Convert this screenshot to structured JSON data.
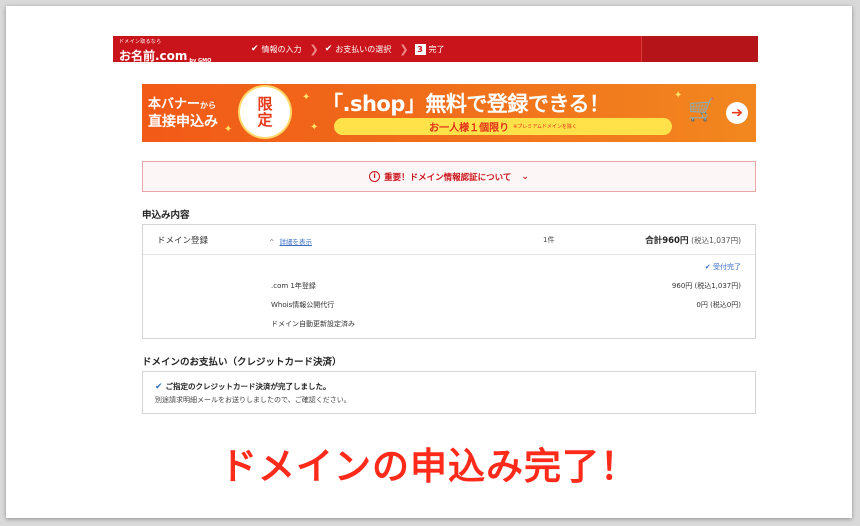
{
  "header": {
    "logo_small": "ドメイン取るなら",
    "logo_main": "お名前.com",
    "logo_gmo": "by GMO",
    "steps": [
      {
        "label": "情報の入力",
        "state": "done"
      },
      {
        "label": "お支払いの選択",
        "state": "done"
      },
      {
        "label": "完了",
        "number": "3",
        "state": "current"
      }
    ]
  },
  "banner": {
    "left_line1": "本バナー",
    "left_line1_small": "から",
    "left_line2": "直接申込み",
    "circle_text1": "限",
    "circle_text2": "定",
    "title": "「.shop」無料で登録できる！",
    "subtitle": "お一人様１個限り",
    "subtitle_note": "※プレミアムドメインを除く",
    "arrow": "➔"
  },
  "notice": {
    "icon": "i",
    "text": "重要！ドメイン情報認証について",
    "chevron": "﹀"
  },
  "order": {
    "section_title": "申込み内容",
    "item_label": "ドメイン登録",
    "detail_caret": "^",
    "detail_link": "詳細を表示",
    "count": "1件",
    "total_label": "合計960円",
    "total_tax": "(税込1,037円)",
    "status": "受付完了",
    "lines": [
      {
        "label": ".com 1年登録",
        "price": "960円 (税込1,037円)"
      },
      {
        "label": "Whois情報公開代行",
        "price": "0円 (税込0円)"
      },
      {
        "label": "ドメイン自動更新設定済み",
        "price": ""
      }
    ]
  },
  "payment": {
    "section_title": "ドメインのお支払い（クレジットカード決済）",
    "line1": "ご指定のクレジットカード決済が完了しました。",
    "line2": "別途請求明細メールをお送りしましたので、ご確認ください。"
  },
  "caption": "ドメインの申込み完了！",
  "colors": {
    "brand_red": "#c9141b",
    "banner_orange": "#f25a17",
    "link_blue": "#3a6fc4",
    "caption_red": "#ff2a1a"
  }
}
